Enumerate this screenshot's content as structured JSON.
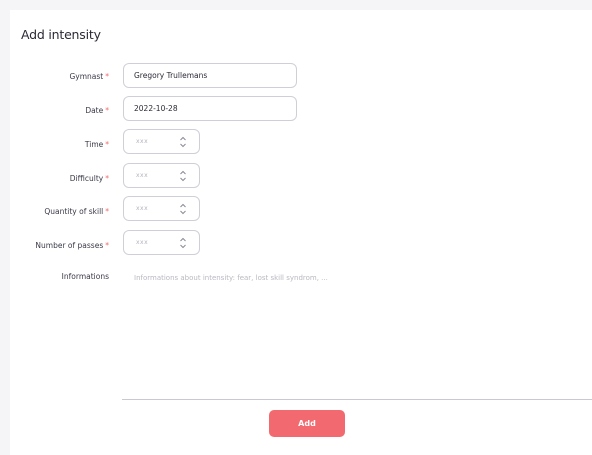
{
  "form": {
    "title": "Add intensity",
    "required_mark": "*",
    "fields": {
      "gymnast": {
        "label": "Gymnast",
        "value": "Gregory Trullemans"
      },
      "date": {
        "label": "Date",
        "value": "2022-10-28"
      },
      "time": {
        "label": "Time",
        "placeholder": "xxx"
      },
      "difficulty": {
        "label": "Difficulty",
        "placeholder": "xxx"
      },
      "quantity_of_skill": {
        "label": "Quantity of skill",
        "placeholder": "xxx"
      },
      "number_of_passes": {
        "label": "Number of passes",
        "placeholder": "xxx"
      },
      "informations": {
        "label": "Informations",
        "placeholder": "Informations about intensity: fear, lost skill syndrom, ..."
      }
    },
    "submit_label": "Add"
  },
  "colors": {
    "accent": "#f26a6f",
    "required": "#f26a6a",
    "border": "#cfcfd8"
  }
}
